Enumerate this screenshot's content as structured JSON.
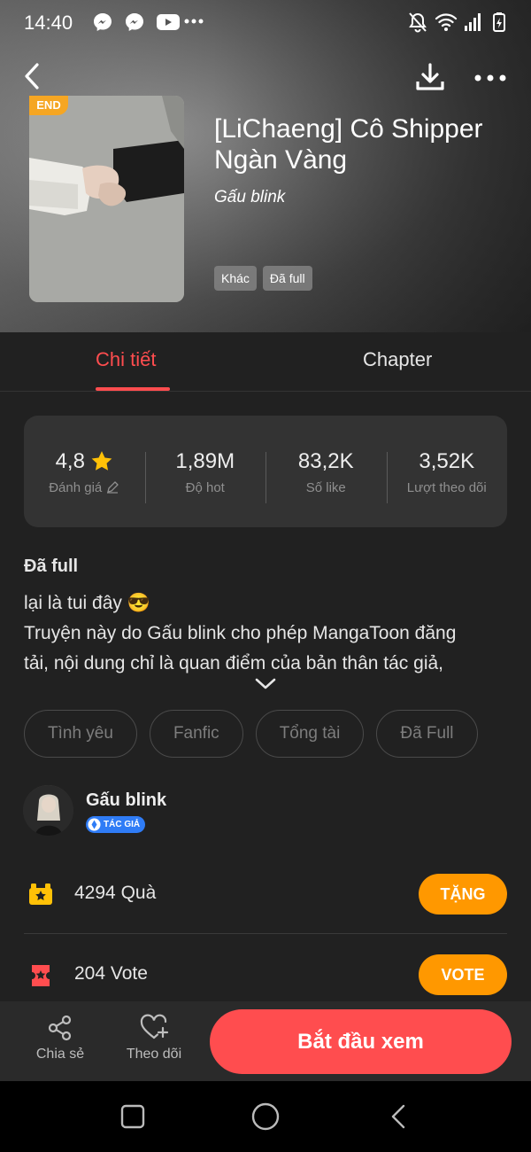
{
  "status_bar": {
    "time": "14:40",
    "left_icons": [
      "messenger-icon",
      "messenger-icon",
      "youtube-icon",
      "more-dots-icon"
    ],
    "right_icons": [
      "notifications-off-icon",
      "wifi-icon",
      "signal-icon",
      "battery-charging-icon"
    ]
  },
  "header": {
    "badge": "END",
    "title": "[LiChaeng] Cô Shipper Ngàn Vàng",
    "author": "Gấu blink",
    "tags": [
      "Khác",
      "Đã full"
    ]
  },
  "tabs": {
    "detail": "Chi tiết",
    "chapter": "Chapter",
    "active": "detail"
  },
  "stats": [
    {
      "value": "4,8",
      "label": "Đánh giá"
    },
    {
      "value": "1,89M",
      "label": "Độ hot"
    },
    {
      "value": "83,2K",
      "label": "Số like"
    },
    {
      "value": "3,52K",
      "label": "Lượt theo dõi"
    }
  ],
  "description": {
    "status": "Đã full",
    "lines": [
      "lại là tui đây 😎",
      "Truyện này do Gấu blink cho phép MangaToon đăng",
      "tải, nội dung chỉ là quan điểm của bản thân tác giả,"
    ]
  },
  "genres": [
    "Tình yêu",
    "Fanfic",
    "Tổng tài",
    "Đã Full"
  ],
  "author_row": {
    "name": "Gấu blink",
    "badge": "TÁC GIẢ"
  },
  "gift": {
    "count": "4294",
    "unit": "Quà",
    "button": "TẶNG"
  },
  "vote": {
    "count": "204",
    "unit": "Vote",
    "button": "VOTE"
  },
  "action_bar": {
    "share": "Chia sẻ",
    "follow": "Theo dõi",
    "start": "Bắt đầu xem"
  },
  "colors": {
    "accent": "#ff4d4f",
    "orange": "#ff9800",
    "badge": "#f5a623",
    "author_badge": "#2f7cf6",
    "star": "#ffc107"
  }
}
